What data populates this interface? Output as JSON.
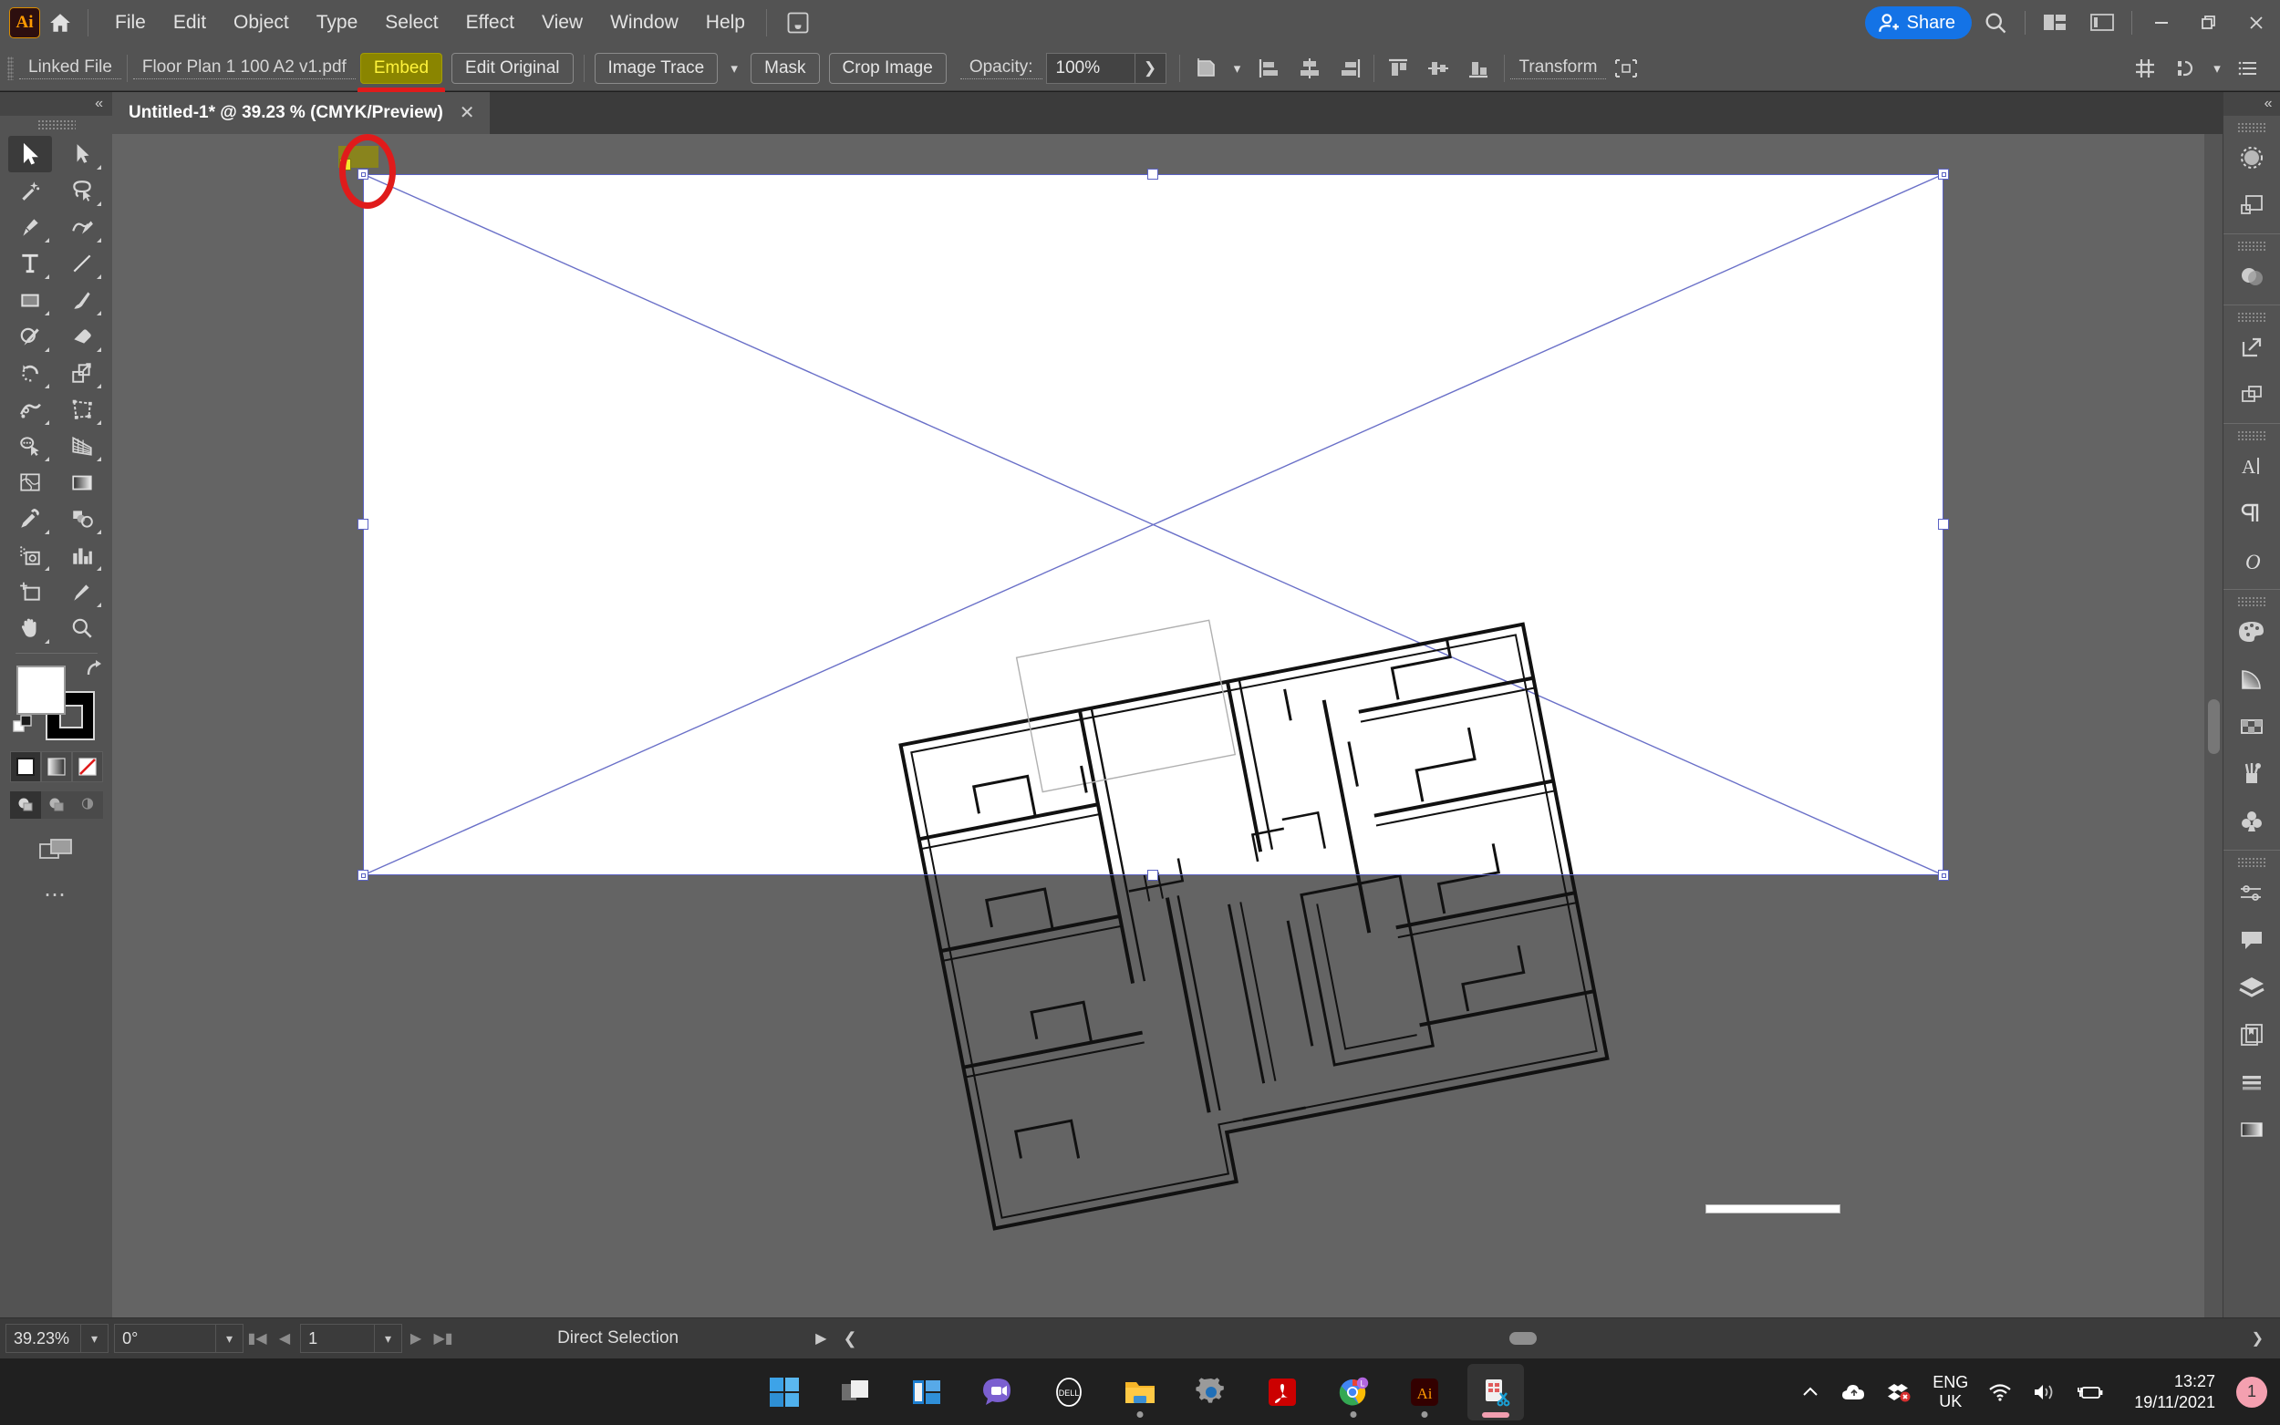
{
  "app": {
    "name": "Adobe Illustrator",
    "logo_text": "Ai"
  },
  "menubar": {
    "items": [
      "File",
      "Edit",
      "Object",
      "Type",
      "Select",
      "Effect",
      "View",
      "Window",
      "Help"
    ],
    "touch_icon": "hand-touch-icon",
    "share_label": "Share",
    "search_icon": "search-icon",
    "arrange_icon": "arrange-documents-icon",
    "workspace_icon": "workspace-switcher-icon",
    "minimize_icon": "minimize-icon",
    "restore_icon": "restore-icon",
    "close_icon": "close-icon"
  },
  "controlbar": {
    "link_status": "Linked File",
    "file_name": "Floor Plan 1 100 A2 v1.pdf",
    "embed_label": "Embed",
    "edit_original_label": "Edit Original",
    "image_trace_label": "Image Trace",
    "mask_label": "Mask",
    "crop_image_label": "Crop Image",
    "opacity_label": "Opacity:",
    "opacity_value": "100%",
    "transform_label": "Transform",
    "icons": {
      "artboard": "artboard-icon",
      "align_left": "align-left-icon",
      "align_center_h": "align-horizontal-center-icon",
      "align_right": "align-right-icon",
      "align_top": "align-top-icon",
      "align_center_v": "align-vertical-center-icon",
      "align_bottom": "align-bottom-icon",
      "isolate": "isolate-selection-icon",
      "snap_grid": "snap-to-grid-icon",
      "select_similar": "select-similar-icon",
      "more_options": "panel-menu-icon"
    }
  },
  "document_tab": {
    "title": "Untitled-1* @ 39.23 % (CMYK/Preview)",
    "close_icon": "close-tab-icon"
  },
  "toolbar": {
    "collapse_icon": "collapse-panel-icon",
    "tools": [
      {
        "name": "selection-tool",
        "active": true
      },
      {
        "name": "direct-selection-tool",
        "active": false
      },
      {
        "name": "magic-wand-tool",
        "active": false
      },
      {
        "name": "lasso-tool",
        "active": false
      },
      {
        "name": "pen-tool",
        "active": false
      },
      {
        "name": "curvature-tool",
        "active": false
      },
      {
        "name": "type-tool",
        "active": false
      },
      {
        "name": "line-segment-tool",
        "active": false
      },
      {
        "name": "rectangle-tool",
        "active": false
      },
      {
        "name": "paintbrush-tool",
        "active": false
      },
      {
        "name": "shaper-tool",
        "active": false
      },
      {
        "name": "eraser-tool",
        "active": false
      },
      {
        "name": "rotate-tool",
        "active": false
      },
      {
        "name": "scale-tool",
        "active": false
      },
      {
        "name": "width-tool",
        "active": false
      },
      {
        "name": "free-transform-tool",
        "active": false
      },
      {
        "name": "shape-builder-tool",
        "active": false
      },
      {
        "name": "perspective-grid-tool",
        "active": false
      },
      {
        "name": "mesh-tool",
        "active": false
      },
      {
        "name": "gradient-tool",
        "active": false
      },
      {
        "name": "eyedropper-tool",
        "active": false
      },
      {
        "name": "blend-tool",
        "active": false
      },
      {
        "name": "symbol-sprayer-tool",
        "active": false
      },
      {
        "name": "column-graph-tool",
        "active": false
      },
      {
        "name": "artboard-tool",
        "active": false
      },
      {
        "name": "slice-tool",
        "active": false
      },
      {
        "name": "hand-tool",
        "active": false
      },
      {
        "name": "zoom-tool",
        "active": false
      }
    ],
    "fill_color": "#ffffff",
    "stroke_color": "#000000",
    "swap_icon": "swap-fill-stroke-icon",
    "default_icon": "default-fill-stroke-icon",
    "modes": [
      "color-fill-icon",
      "gradient-fill-icon",
      "none-fill-icon"
    ],
    "draw_modes": [
      "draw-normal-icon",
      "draw-behind-icon",
      "draw-inside-icon"
    ],
    "screen_mode_icon": "change-screen-mode-icon",
    "edit_toolbar_icon": "edit-toolbar-ellipsis-icon"
  },
  "right_panel": {
    "collapse_icon": "collapse-panel-icon",
    "groups": [
      [
        "properties-icon",
        "libraries-icon"
      ],
      [
        "transparency-icon"
      ],
      [
        "export-icon",
        "asset-export-icon"
      ],
      [
        "character-icon",
        "paragraph-icon",
        "glyphs-icon"
      ],
      [
        "color-icon",
        "color-guide-icon",
        "swatches-icon",
        "brushes-icon",
        "symbols-icon"
      ],
      [
        "stroke-icon",
        "comments-icon",
        "layers-icon",
        "artboards-icon",
        "align-icon",
        "gradient-icon"
      ]
    ]
  },
  "canvas": {
    "zoom_level": "39.23%",
    "rotation": "0°",
    "artboard_number": "1",
    "status_text": "Direct Selection",
    "selection_color": "#5b62c4",
    "anchor_highlight_color": "#8f8a10",
    "annotation_color": "#e01b1b",
    "artboard_background": "#ffffff",
    "canvas_background": "#646464",
    "nav_first_icon": "first-artboard-icon",
    "nav_prev_icon": "previous-artboard-icon",
    "nav_next_icon": "next-artboard-icon",
    "nav_last_icon": "last-artboard-icon"
  },
  "taskbar": {
    "apps": [
      {
        "name": "start-button",
        "label": "Start"
      },
      {
        "name": "task-view-button",
        "label": "Task View"
      },
      {
        "name": "widgets-button",
        "label": "Widgets"
      },
      {
        "name": "teams-button",
        "label": "Microsoft Teams"
      },
      {
        "name": "dell-button",
        "label": "Dell"
      },
      {
        "name": "file-explorer-button",
        "label": "File Explorer"
      },
      {
        "name": "settings-button",
        "label": "Settings"
      },
      {
        "name": "acrobat-reader-button",
        "label": "Adobe Acrobat Reader"
      },
      {
        "name": "chrome-button",
        "label": "Google Chrome"
      },
      {
        "name": "illustrator-button",
        "label": "Adobe Illustrator"
      },
      {
        "name": "snipping-tool-button",
        "label": "Snipping Tool"
      }
    ],
    "tray": {
      "overflow_icon": "show-hidden-icons-icon",
      "onedrive_icon": "onedrive-icon",
      "dropbox_icon": "dropbox-icon",
      "language": "ENG",
      "language_region": "UK",
      "wifi_icon": "wifi-icon",
      "volume_icon": "volume-icon",
      "battery_icon": "battery-charging-icon",
      "time": "13:27",
      "date": "19/11/2021",
      "notification_count": "1"
    }
  }
}
